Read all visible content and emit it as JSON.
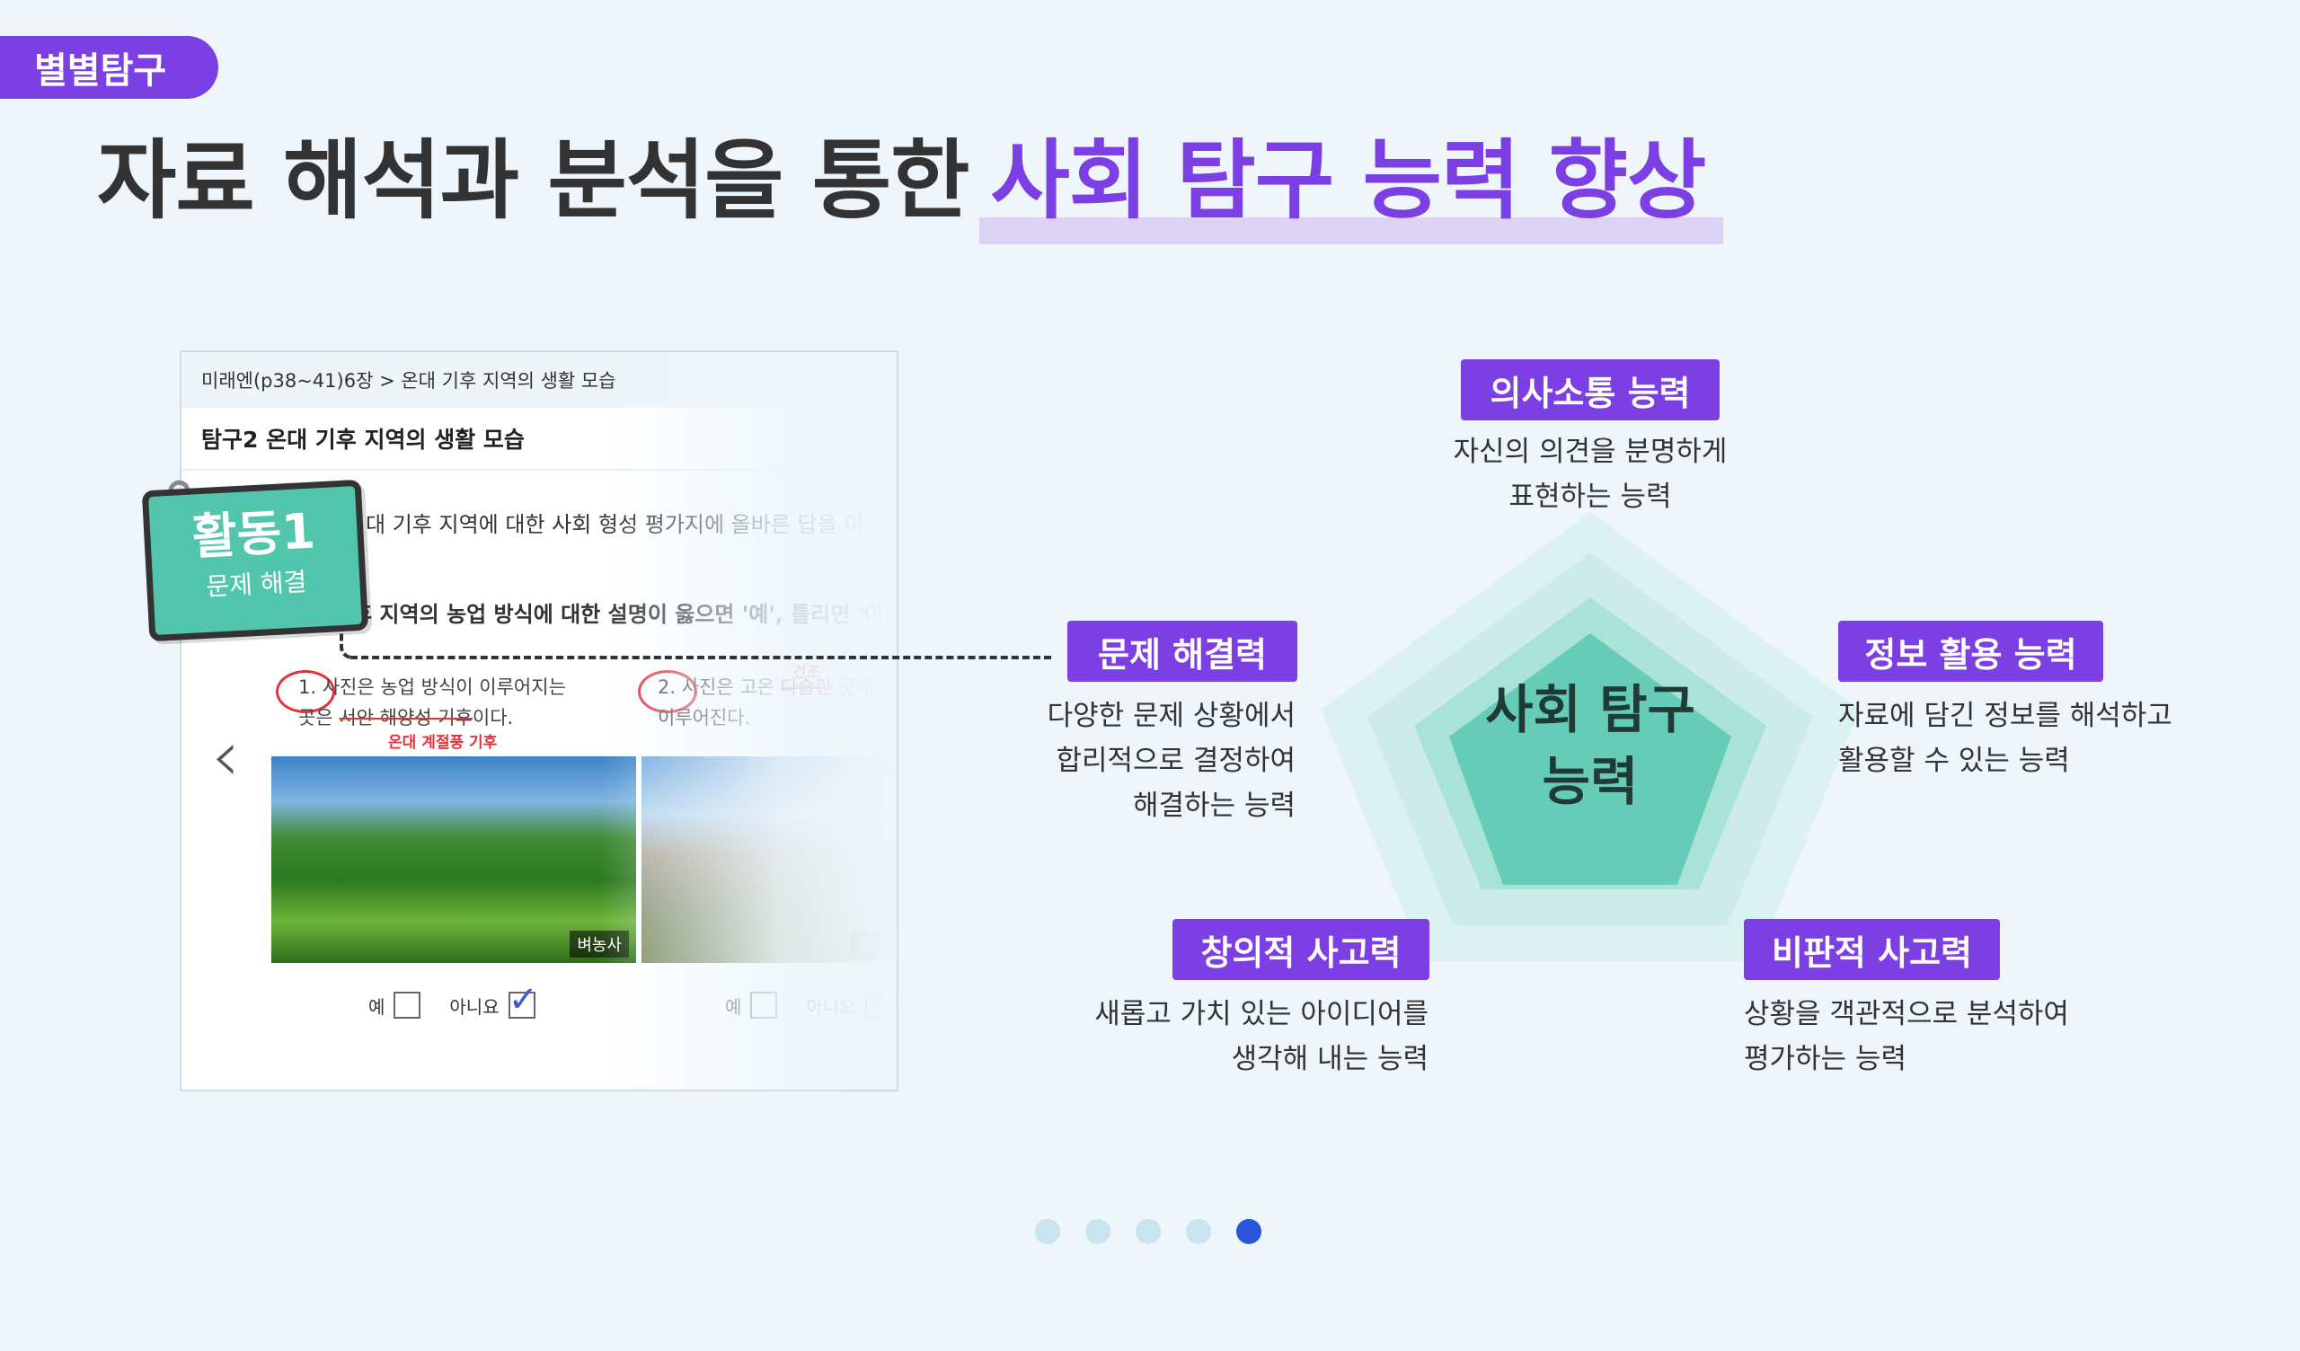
{
  "badge": {
    "label": "별별탐구"
  },
  "headline": {
    "prefix": "자료 해석과 분석을 통한",
    "highlight": "사회 탐구 능력 향상"
  },
  "document": {
    "breadcrumb": "미래엔(p38~41)6장 > 온대 기후 지역의 생활 모습",
    "title": "탐구2 온대 기후 지역의 생활 모습",
    "question1": "대 기후 지역에 대한 사회 형성 평가지에 올바른 답을 이",
    "question2": "후 지역의 농업 방식에 대한 설명이 옳으면 '예', 틀리면 '아니",
    "option1_line1": "1. 사진은 농업 방식이 이루어지는",
    "option1_line2_prefix": "곳은 ",
    "option1_line2_strike": "서안 해양성 기후",
    "option1_line2_suffix": "이다.",
    "option1_correction": "온대 계절풍 기후",
    "option2_line1_prefix": "2. 사진은 고온 ",
    "option2_line1_strike": "다습한",
    "option2_line1_suffix": " 곳에서",
    "option2_line2": "이루어진다.",
    "option2_correction": "건조",
    "photo1_label": "벼농사",
    "photo2_label": "올리",
    "yes_label": "예",
    "no_label": "아니요",
    "tick_glyph": "✓",
    "prev_glyph": "‹"
  },
  "activity": {
    "title": "활동1",
    "subtitle": "문제 해결"
  },
  "pentagon": {
    "center_line1": "사회 탐구",
    "center_line2": "능력"
  },
  "skills": [
    {
      "label": "의사소통 능력",
      "desc_line1": "자신의 의견을 분명하게",
      "desc_line2": "표현하는 능력"
    },
    {
      "label": "정보 활용 능력",
      "desc_line1": "자료에 담긴 정보를 해석하고",
      "desc_line2": "활용할 수 있는 능력"
    },
    {
      "label": "문제 해결력",
      "desc_line1": "다양한 문제 상황에서",
      "desc_line2": "합리적으로 결정하여",
      "desc_line3": "해결하는 능력"
    },
    {
      "label": "창의적 사고력",
      "desc_line1": "새롭고 가치 있는 아이디어를",
      "desc_line2": "생각해 내는 능력"
    },
    {
      "label": "비판적 사고력",
      "desc_line1": "상황을 객관적으로 분석하여",
      "desc_line2": "평가하는 능력"
    }
  ],
  "pagination": {
    "total": 5,
    "active_index": 4
  },
  "colors": {
    "accent": "#7b3fe4",
    "teal": "#52c6ad",
    "active_dot": "#2955d9"
  }
}
